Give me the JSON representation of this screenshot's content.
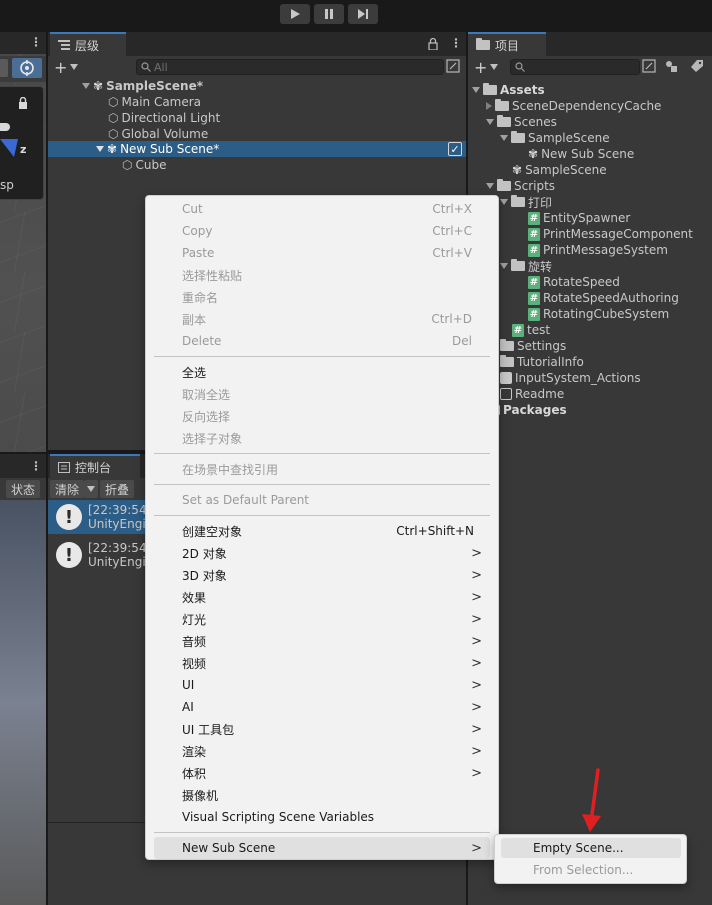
{
  "toolbar": {
    "play_icon": "play-icon",
    "pause_icon": "pause-icon",
    "step_icon": "step-icon"
  },
  "scene": {
    "gizmo_axis_z": "z",
    "label_fragment": "sp"
  },
  "game": {
    "tab_label": "状态"
  },
  "hierarchy": {
    "tab_label": "层级",
    "search_placeholder": "All",
    "rows": [
      {
        "label": "SampleScene*"
      },
      {
        "label": "Main Camera"
      },
      {
        "label": "Directional Light"
      },
      {
        "label": "Global Volume"
      },
      {
        "label": "New Sub Scene*"
      },
      {
        "label": "Cube"
      }
    ]
  },
  "console": {
    "tab_label": "控制台",
    "clear_label": "清除",
    "collapse_label": "折叠",
    "logs": [
      {
        "time": "[22:39:54",
        "source": "UnityEngi"
      },
      {
        "time": "[22:39:54",
        "source": "UnityEngi"
      }
    ]
  },
  "project": {
    "tab_label": "项目",
    "tree": [
      {
        "label": "Assets"
      },
      {
        "label": "SceneDependencyCache"
      },
      {
        "label": "Scenes"
      },
      {
        "label": "SampleScene"
      },
      {
        "label": "New Sub Scene"
      },
      {
        "label": "SampleScene"
      },
      {
        "label": "Scripts"
      },
      {
        "label": "打印"
      },
      {
        "label": "EntitySpawner"
      },
      {
        "label": "PrintMessageComponent"
      },
      {
        "label": "PrintMessageSystem"
      },
      {
        "label": "旋转"
      },
      {
        "label": "RotateSpeed"
      },
      {
        "label": "RotateSpeedAuthoring"
      },
      {
        "label": "RotatingCubeSystem"
      },
      {
        "label": "test"
      },
      {
        "label": "Settings"
      },
      {
        "label": "TutorialInfo"
      },
      {
        "label": "InputSystem_Actions"
      },
      {
        "label": "Readme"
      },
      {
        "label": "Packages"
      }
    ]
  },
  "context_menu": {
    "group1": [
      {
        "label": "Cut",
        "shortcut": "Ctrl+X"
      },
      {
        "label": "Copy",
        "shortcut": "Ctrl+C"
      },
      {
        "label": "Paste",
        "shortcut": "Ctrl+V"
      },
      {
        "label": "选择性粘贴",
        "shortcut": ""
      },
      {
        "label": "重命名",
        "shortcut": ""
      },
      {
        "label": "副本",
        "shortcut": "Ctrl+D"
      },
      {
        "label": "Delete",
        "shortcut": "Del"
      }
    ],
    "group2": [
      {
        "label": "全选"
      },
      {
        "label": "取消全选"
      },
      {
        "label": "反向选择"
      },
      {
        "label": "选择子对象"
      }
    ],
    "find_refs": "在场景中查找引用",
    "set_default_parent": "Set as Default Parent",
    "group3": [
      {
        "label": "创建空对象",
        "shortcut": "Ctrl+Shift+N"
      },
      {
        "label": "2D 对象"
      },
      {
        "label": "3D 对象"
      },
      {
        "label": "效果"
      },
      {
        "label": "灯光"
      },
      {
        "label": "音频"
      },
      {
        "label": "视频"
      },
      {
        "label": "UI"
      },
      {
        "label": "AI"
      },
      {
        "label": "UI 工具包"
      },
      {
        "label": "渲染"
      },
      {
        "label": "体积"
      },
      {
        "label": "摄像机"
      },
      {
        "label": "Visual Scripting Scene Variables"
      }
    ],
    "new_sub_scene": "New Sub Scene",
    "submenu_arrow": ">"
  },
  "submenu": {
    "empty_scene": "Empty Scene...",
    "from_selection": "From Selection..."
  },
  "colors": {
    "selection": "#2c5d87",
    "accent_tab": "#3a79bb",
    "annotation_arrow": "#e02020"
  }
}
